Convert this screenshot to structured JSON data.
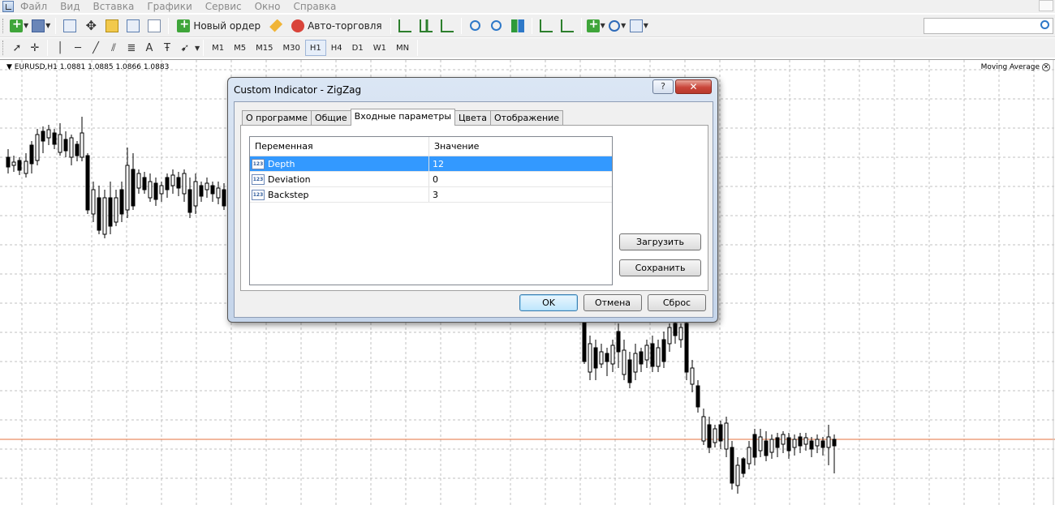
{
  "menubar": {
    "items": [
      "Файл",
      "Вид",
      "Вставка",
      "Графики",
      "Сервис",
      "Окно",
      "Справка"
    ]
  },
  "toolbar": {
    "new_order_label": "Новый ордер",
    "auto_trading_label": "Авто-торговля",
    "timeframes": [
      "M1",
      "M5",
      "M15",
      "M30",
      "H1",
      "H4",
      "D1",
      "W1",
      "MN"
    ],
    "active_timeframe": "H1",
    "text_tool_label": "A"
  },
  "chart": {
    "symbol_info": "EURUSD,H1  1.0881 1.0885 1.0866 1.0883",
    "indicator_label": "Moving Average",
    "grid_color": "#c0c0c0",
    "price_line_color": "#e4703c"
  },
  "dialog": {
    "title": "Custom Indicator - ZigZag",
    "help_label": "?",
    "close_label": "✕",
    "tabs": [
      "О программе",
      "Общие",
      "Входные параметры",
      "Цвета",
      "Отображение"
    ],
    "active_tab": "Входные параметры",
    "table": {
      "headers": [
        "Переменная",
        "Значение"
      ],
      "rows": [
        {
          "icon": "123",
          "name": "Depth",
          "value": "12"
        },
        {
          "icon": "123",
          "name": "Deviation",
          "value": "0"
        },
        {
          "icon": "123",
          "name": "Backstep",
          "value": "3"
        }
      ],
      "selected_row": 0
    },
    "load_label": "Загрузить",
    "save_label": "Сохранить",
    "ok_label": "OK",
    "cancel_label": "Отмена",
    "reset_label": "Сброс"
  }
}
